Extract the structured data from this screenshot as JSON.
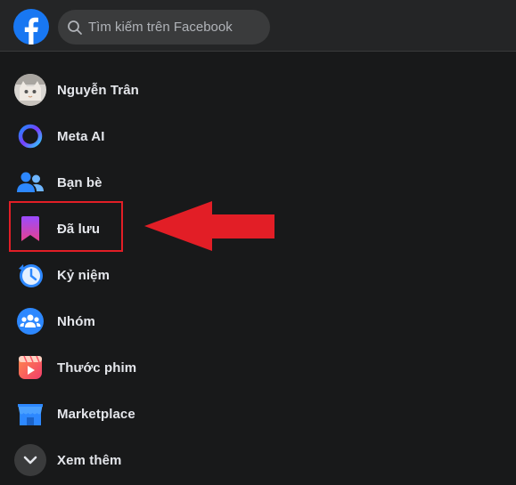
{
  "search": {
    "placeholder": "Tìm kiếm trên Facebook"
  },
  "sidebar": {
    "items": [
      {
        "label": "Nguyễn Trân",
        "icon": "profile-avatar"
      },
      {
        "label": "Meta AI",
        "icon": "meta-ai-ring-icon"
      },
      {
        "label": "Bạn bè",
        "icon": "friends-icon"
      },
      {
        "label": "Đã lưu",
        "icon": "saved-bookmark-icon"
      },
      {
        "label": "Kỷ niệm",
        "icon": "memories-clock-icon"
      },
      {
        "label": "Nhóm",
        "icon": "groups-icon"
      },
      {
        "label": "Thước phim",
        "icon": "reels-icon"
      },
      {
        "label": "Marketplace",
        "icon": "marketplace-icon"
      },
      {
        "label": "Xem thêm",
        "icon": "chevron-down-icon"
      }
    ]
  },
  "colors": {
    "background": "#18191a",
    "topbar": "#242526",
    "facebook_blue": "#1877f2",
    "annotation_red": "#e21e26"
  }
}
